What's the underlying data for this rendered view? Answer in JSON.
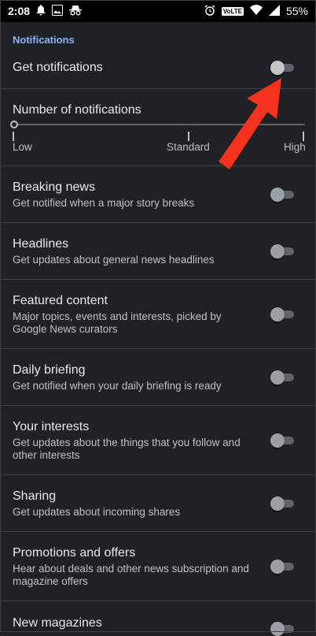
{
  "status_bar": {
    "time": "2:08",
    "network": "VoLTE",
    "battery": "55%",
    "left_icons": [
      "bell-icon",
      "image-icon",
      "incognito-icon"
    ],
    "right_icons": [
      "alarm-icon",
      "wifi-icon",
      "signal-icon"
    ]
  },
  "section": {
    "title": "Notifications"
  },
  "get_notifications": {
    "label": "Get notifications",
    "enabled": false
  },
  "frequency": {
    "label": "Number of notifications",
    "ticks": [
      "Low",
      "Standard",
      "High"
    ]
  },
  "items": [
    {
      "title": "Breaking news",
      "subtitle": "Get notified when a major story breaks",
      "enabled": false
    },
    {
      "title": "Headlines",
      "subtitle": "Get updates about general news headlines",
      "enabled": false
    },
    {
      "title": "Featured content",
      "subtitle": "Major topics, events and interests, picked by",
      "subtitle2": "Google News curators",
      "enabled": false
    },
    {
      "title": "Daily briefing",
      "subtitle": "Get notified when your daily briefing is ready",
      "enabled": false
    },
    {
      "title": "Your interests",
      "subtitle": "Get updates about the things that you follow and",
      "subtitle2": "other interests",
      "enabled": false
    },
    {
      "title": "Sharing",
      "subtitle": "Get updates about incoming shares",
      "enabled": false
    },
    {
      "title": "Promotions and offers",
      "subtitle": "Hear about deals and other news subscription and",
      "subtitle2": "magazine offers",
      "enabled": false
    },
    {
      "title": "New magazines",
      "enabled": false
    }
  ],
  "colors": {
    "background": "#202124",
    "accent": "#8ab4f8",
    "annotation_arrow": "#f5321e"
  }
}
